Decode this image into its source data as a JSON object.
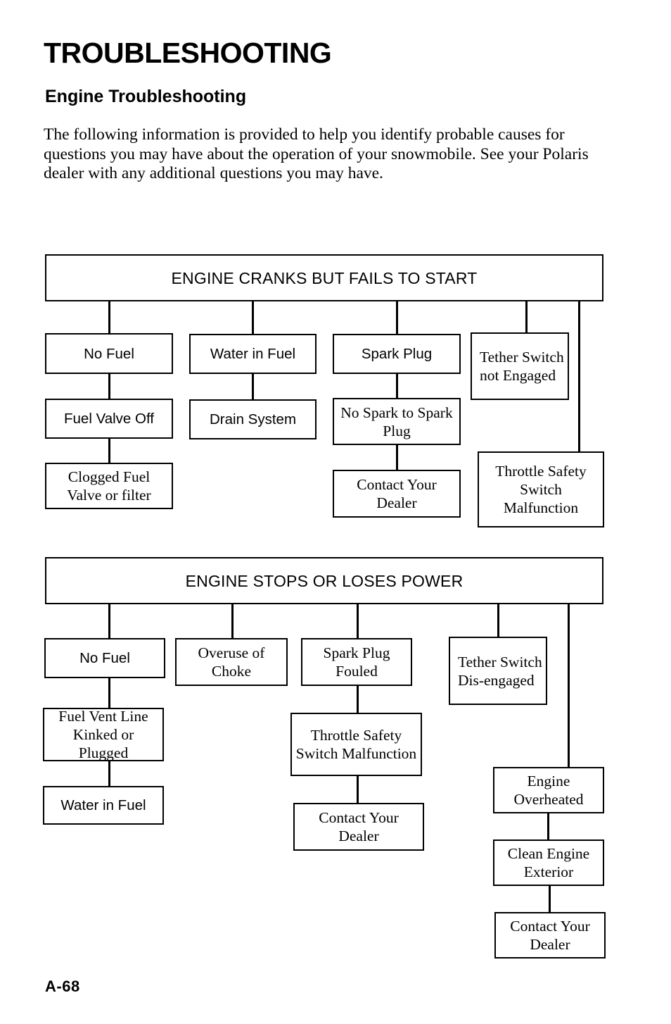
{
  "document": {
    "title": "TROUBLESHOOTING",
    "section_title": "Engine Troubleshooting",
    "intro": "The following information is provided to help you identify probable causes for questions you may have about the operation of your snowmobile.  See your Polaris dealer with any additional questions you may have.",
    "page_number": "A-68"
  },
  "chart1": {
    "header": "ENGINE CRANKS BUT FAILS TO START",
    "nodes": {
      "no_fuel": "No Fuel",
      "fuel_valve_off": "Fuel Valve Off",
      "clogged_fuel_valve": "Clogged Fuel Valve or filter",
      "water_in_fuel": "Water in Fuel",
      "drain_system": "Drain System",
      "spark_plug": "Spark Plug",
      "no_spark": "No Spark to Spark Plug",
      "contact_dealer": "Contact Your Dealer",
      "tether_not_engaged": "Tether Switch not Engaged",
      "throttle_safety": "Throttle Safety Switch Malfunction"
    }
  },
  "chart2": {
    "header": "ENGINE STOPS OR LOSES POWER",
    "nodes": {
      "no_fuel": "No Fuel",
      "fuel_vent_line": "Fuel Vent Line Kinked or Plugged",
      "water_in_fuel": "Water in Fuel",
      "overuse_of_choke": "Overuse of Choke",
      "spark_plug_fouled": "Spark Plug Fouled",
      "throttle_safety": "Throttle Safety Switch Malfunction",
      "contact_dealer": "Contact Your Dealer",
      "tether_disengaged": "Tether Switch Dis-engaged",
      "engine_overheated": "Engine Overheated",
      "clean_engine_exterior": "Clean Engine Exterior",
      "contact_dealer2": "Contact Your Dealer"
    }
  }
}
